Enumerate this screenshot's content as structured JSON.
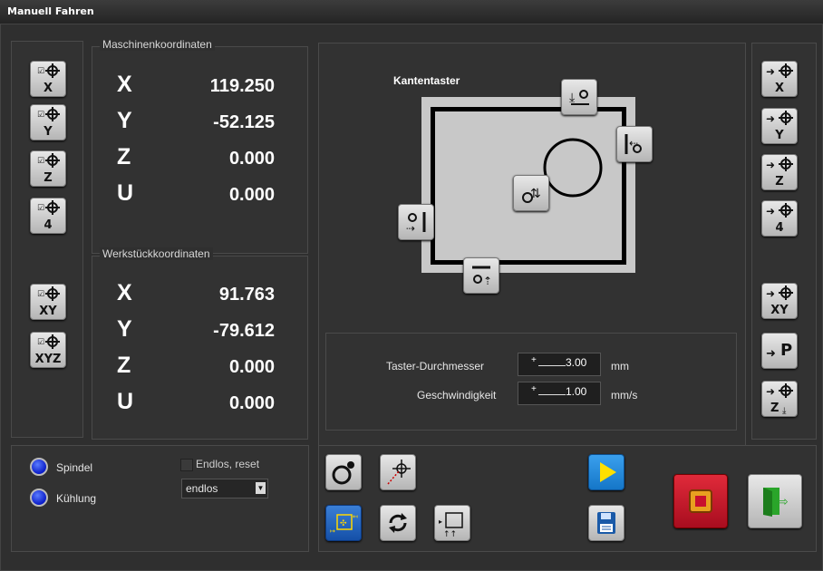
{
  "window": {
    "title": "Manuell Fahren"
  },
  "machine": {
    "label": "Maschinenkoordinaten",
    "axes": [
      {
        "name": "X",
        "value": "119.250"
      },
      {
        "name": "Y",
        "value": "-52.125"
      },
      {
        "name": "Z",
        "value": "0.000"
      },
      {
        "name": "U",
        "value": "0.000"
      }
    ]
  },
  "workpiece": {
    "label": "Werkstückkoordinaten",
    "axes": [
      {
        "name": "X",
        "value": "91.763"
      },
      {
        "name": "Y",
        "value": "-79.612"
      },
      {
        "name": "Z",
        "value": "0.000"
      },
      {
        "name": "U",
        "value": "0.000"
      }
    ]
  },
  "left_buttons": {
    "x": "X",
    "y": "Y",
    "z": "Z",
    "four": "4",
    "xy": "XY",
    "xyz": "XYZ"
  },
  "right_buttons": {
    "x": "X",
    "y": "Y",
    "z": "Z",
    "four": "4",
    "xy": "XY",
    "p": "P",
    "zdown": "Z"
  },
  "edge_finder": {
    "title": "Kantentaster"
  },
  "probe": {
    "diameter_label": "Taster-Durchmesser",
    "diameter_value": "3.00",
    "diameter_unit": "mm",
    "speed_label": "Geschwindigkeit",
    "speed_value": "1.00",
    "speed_unit": "mm/s",
    "sign": "+"
  },
  "controls": {
    "spindle": "Spindel",
    "cooling": "Kühlung",
    "endless_checkbox": "Endlos, reset",
    "endless_select": "endlos"
  },
  "colors": {
    "play": "#1a8fe0",
    "stop": "#c8102e",
    "exit": "#2aa52a"
  }
}
